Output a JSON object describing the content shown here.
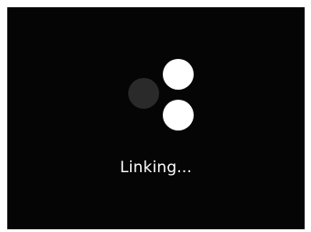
{
  "screen": {
    "background": "#060505"
  },
  "spinner": {
    "icon": "loading-dots-icon",
    "dots": [
      {
        "name": "top",
        "color": "#ffffff"
      },
      {
        "name": "left",
        "color": "#2a2a2a"
      },
      {
        "name": "bottom",
        "color": "#ffffff"
      }
    ]
  },
  "status": {
    "text": "Linking..."
  }
}
